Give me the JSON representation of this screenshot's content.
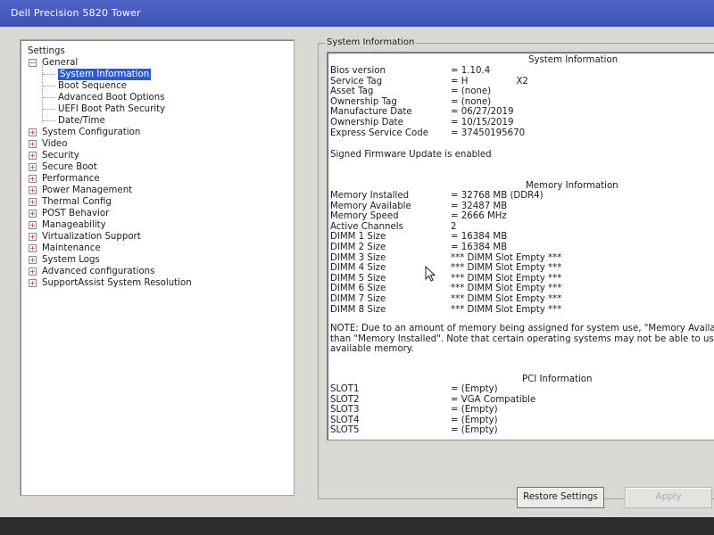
{
  "window": {
    "title": "Dell Precision 5820 Tower"
  },
  "tree": {
    "root": "Settings",
    "general": "General",
    "general_children": [
      "System Information",
      "Boot Sequence",
      "Advanced Boot Options",
      "UEFI Boot Path Security",
      "Date/Time"
    ],
    "selected": "System Information",
    "items": [
      "System Configuration",
      "Video",
      "Security",
      "Secure Boot",
      "Performance",
      "Power Management",
      "Thermal Config",
      "POST Behavior",
      "Manageability",
      "Virtualization Support",
      "Maintenance",
      "System Logs",
      "Advanced configurations",
      "SupportAssist System Resolution"
    ]
  },
  "panel": {
    "group_title": "System Information"
  },
  "sysinfo": {
    "title": "System Information",
    "rows": [
      {
        "label": "Bios version",
        "value": "= 1.10.4"
      },
      {
        "label": "Service Tag",
        "value": "= H",
        "value_suffix": "X2"
      },
      {
        "label": "Asset Tag",
        "value": "= (none)"
      },
      {
        "label": "Ownership Tag",
        "value": "= (none)"
      },
      {
        "label": "Manufacture Date",
        "value": "= 06/27/2019"
      },
      {
        "label": "Ownership Date",
        "value": "= 10/15/2019"
      },
      {
        "label": "Express Service Code",
        "value": "= 37450195670"
      }
    ],
    "firmware_note": "Signed Firmware Update is enabled"
  },
  "meminfo": {
    "title": "Memory Information",
    "rows": [
      {
        "label": "Memory Installed",
        "value": "= 32768 MB (DDR4)"
      },
      {
        "label": "Memory Available",
        "value": "= 32487 MB"
      },
      {
        "label": "Memory Speed",
        "value": "= 2666 MHz"
      },
      {
        "label": "Active Channels",
        "value": "2"
      },
      {
        "label": "DIMM 1 Size",
        "value": "= 16384 MB"
      },
      {
        "label": "DIMM 2 Size",
        "value": "= 16384 MB"
      },
      {
        "label": "DIMM 3 Size",
        "value": "*** DIMM Slot Empty ***"
      },
      {
        "label": "DIMM 4 Size",
        "value": "*** DIMM Slot Empty ***"
      },
      {
        "label": "DIMM 5 Size",
        "value": "*** DIMM Slot Empty ***"
      },
      {
        "label": "DIMM 6 Size",
        "value": "*** DIMM Slot Empty ***"
      },
      {
        "label": "DIMM 7 Size",
        "value": "*** DIMM Slot Empty ***"
      },
      {
        "label": "DIMM 8 Size",
        "value": "*** DIMM Slot Empty ***"
      }
    ],
    "note_lines": [
      "NOTE: Due to an amount of memory being assigned for system use, \"Memory Availab",
      "than \"Memory Installed\". Note that certain operating systems may not be able to use al",
      "available memory."
    ]
  },
  "pciinfo": {
    "title": "PCI Information",
    "rows": [
      {
        "label": "SLOT1",
        "value": "= (Empty)"
      },
      {
        "label": "SLOT2",
        "value": "= VGA Compatible"
      },
      {
        "label": "SLOT3",
        "value": "= (Empty)"
      },
      {
        "label": "SLOT4",
        "value": "= (Empty)"
      },
      {
        "label": "SLOT5",
        "value": "= (Empty)"
      }
    ]
  },
  "buttons": {
    "restore": "Restore Settings",
    "apply": "Apply"
  },
  "colors": {
    "titlebar": "#4359bd",
    "selection": "#2c5bd0",
    "background": "#d9d8d3"
  }
}
